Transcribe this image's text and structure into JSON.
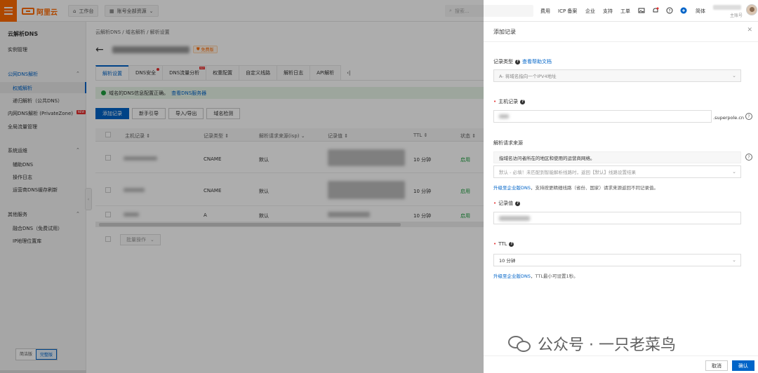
{
  "topbar": {
    "brand": "阿里云",
    "workbench": "工作台",
    "resource_scope": "账号全部资源",
    "search_placeholder": "搜索...",
    "links": [
      "费用",
      "ICP 备案",
      "企业",
      "支持",
      "工单"
    ],
    "language": "简体",
    "user_sub": "主账号"
  },
  "sidebar": {
    "title": "云解析DNS",
    "instance": "实例管理",
    "groups": [
      {
        "label": "公网DNS解析",
        "items": [
          "权威解析",
          "递归解析（公共DNS）"
        ]
      },
      {
        "label": "内网DNS解析 (PrivateZone)",
        "badge": "NEW"
      },
      {
        "label": "全局流量管理"
      },
      {
        "label": "系统运维",
        "items": [
          "辅助DNS",
          "操作日志",
          "运营商DNS缓存刷新"
        ]
      },
      {
        "label": "其他服务",
        "items": [
          "融合DNS（免费试用）",
          "IP地理位置库"
        ]
      }
    ],
    "mode_simple": "简洁版",
    "mode_full": "完整版"
  },
  "main": {
    "breadcrumb": "云解析DNS  /  域名解析  /  解析设置",
    "free_badge": "免费版",
    "tabs": [
      "解析设置",
      "DNS安全",
      "DNS流量分析",
      "权重配置",
      "自定义线路",
      "解析日志",
      "API解析"
    ],
    "notice": "域名的DNS信息配置正确。",
    "notice_link": "查看DNS服务器",
    "actions": [
      "添加记录",
      "新手引导",
      "导入/导出",
      "域名检测"
    ],
    "columns": [
      "主机记录",
      "记录类型",
      "解析请求来源(isp)",
      "记录值",
      "TTL",
      "状态"
    ],
    "rows": [
      {
        "type": "CNAME",
        "isp": "默认",
        "ttl": "10 分钟",
        "status": "启用"
      },
      {
        "type": "CNAME",
        "isp": "默认",
        "ttl": "10 分钟",
        "status": "启用"
      },
      {
        "type": "A",
        "isp": "默认",
        "ttl": "10 分钟",
        "status": "启用"
      }
    ],
    "batch": "批量操作"
  },
  "drawer": {
    "title": "添加记录",
    "record_type_label": "记录类型",
    "record_type_help": "查看帮助文档",
    "record_type_value": "A- 将域名指向一个IPV4地址",
    "host_label": "主机记录",
    "host_suffix": ".superpole.cn",
    "source_label": "解析请求来源",
    "source_tip": "指域名访问者所在的地区和使用的运营商网络。",
    "source_value": "默认 - 必填！未匹配到智能解析线路时，返回【默认】线路设置结果",
    "source_note_link": "升级至企业版DNS",
    "source_note": "，支持按更精细线路（省份、国家）请求来源返回不同记录值。",
    "value_label": "记录值",
    "ttl_label": "TTL",
    "ttl_value": "10 分钟",
    "ttl_note_link": "升级至企业版DNS",
    "ttl_note": "，TTL最小可设置1秒。",
    "cancel": "取消",
    "confirm": "确认"
  },
  "watermark": "公众号 · 一只老菜鸟"
}
